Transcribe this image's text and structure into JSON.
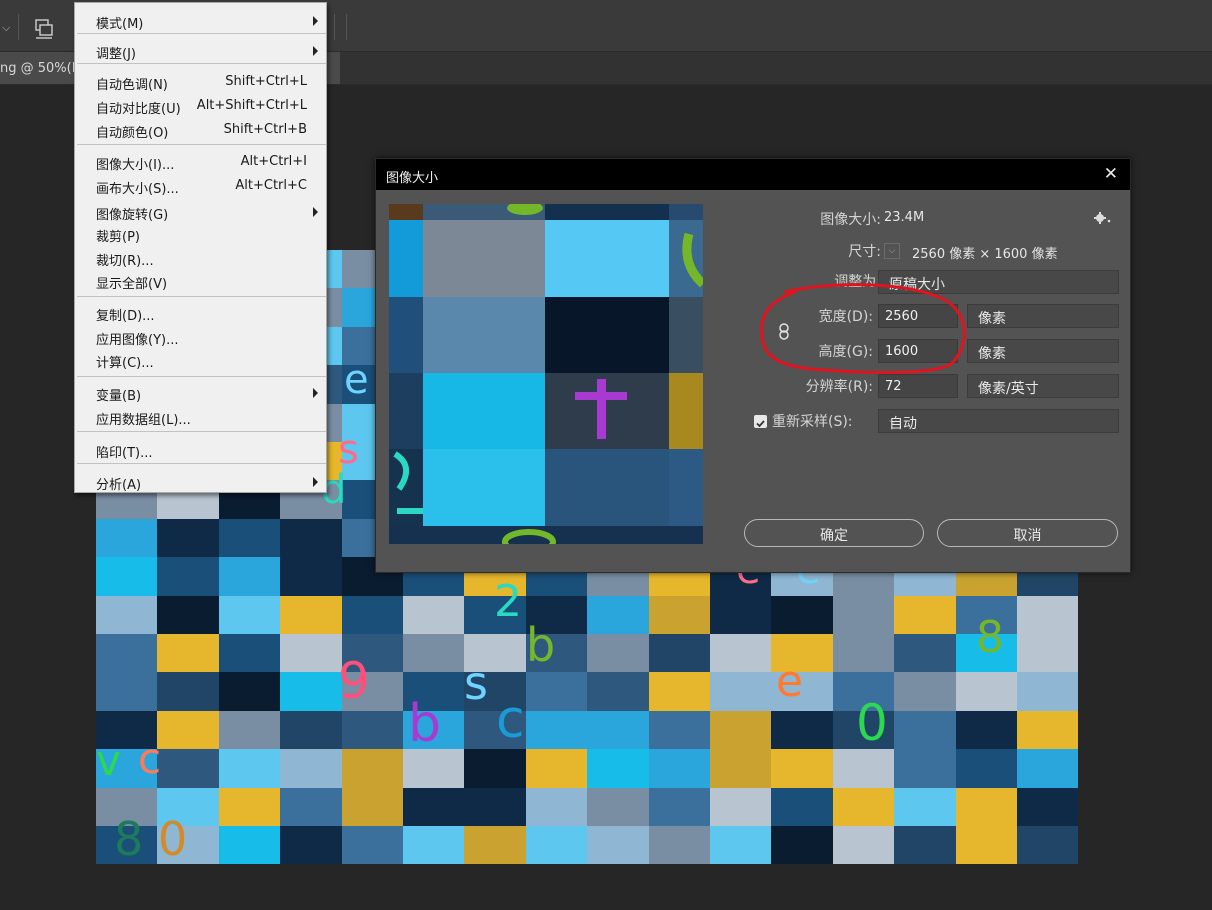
{
  "document": {
    "tab_title": "ng @ 50%(R"
  },
  "menu": {
    "items": [
      {
        "label": "模式(M)",
        "shortcut": "",
        "submenu": true
      },
      {
        "label": "调整(J)",
        "shortcut": "",
        "submenu": true
      },
      {
        "label": "自动色调(N)",
        "shortcut": "Shift+Ctrl+L",
        "submenu": false
      },
      {
        "label": "自动对比度(U)",
        "shortcut": "Alt+Shift+Ctrl+L",
        "submenu": false
      },
      {
        "label": "自动颜色(O)",
        "shortcut": "Shift+Ctrl+B",
        "submenu": false
      },
      {
        "label": "图像大小(I)...",
        "shortcut": "Alt+Ctrl+I",
        "submenu": false
      },
      {
        "label": "画布大小(S)...",
        "shortcut": "Alt+Ctrl+C",
        "submenu": false
      },
      {
        "label": "图像旋转(G)",
        "shortcut": "",
        "submenu": true
      },
      {
        "label": "裁剪(P)",
        "shortcut": "",
        "submenu": false
      },
      {
        "label": "裁切(R)...",
        "shortcut": "",
        "submenu": false
      },
      {
        "label": "显示全部(V)",
        "shortcut": "",
        "submenu": false
      },
      {
        "label": "复制(D)...",
        "shortcut": "",
        "submenu": false
      },
      {
        "label": "应用图像(Y)...",
        "shortcut": "",
        "submenu": false
      },
      {
        "label": "计算(C)...",
        "shortcut": "",
        "submenu": false
      },
      {
        "label": "变量(B)",
        "shortcut": "",
        "submenu": true
      },
      {
        "label": "应用数据组(L)...",
        "shortcut": "",
        "submenu": false
      },
      {
        "label": "陷印(T)...",
        "shortcut": "",
        "submenu": false
      },
      {
        "label": "分析(A)",
        "shortcut": "",
        "submenu": true
      }
    ]
  },
  "dialog": {
    "title": "图像大小",
    "close_glyph": "✕",
    "image_size_label": "图像大小:",
    "image_size_value": "23.4M",
    "dimensions_label": "尺寸:",
    "dimensions_value": "2560 像素 × 1600 像素",
    "fit_to_label": "调整为:",
    "fit_to_value": "原稿大小",
    "width_label": "宽度(D):",
    "width_value": "2560",
    "width_unit": "像素",
    "height_label": "高度(G):",
    "height_value": "1600",
    "height_unit": "像素",
    "resolution_label": "分辨率(R):",
    "resolution_value": "72",
    "resolution_unit": "像素/英寸",
    "resample_label": "重新采样(S):",
    "resample_checked": true,
    "resample_value": "自动",
    "ok_label": "确定",
    "cancel_label": "取消"
  },
  "icons": {
    "gear": "gear-icon",
    "link": "chain-link-icon",
    "dimensions_toggle": "chevron-down-icon",
    "arrange": "arrange-documents-icon"
  },
  "colors": {
    "annotation_circle": "#e0141e",
    "dialog_bg": "#535353",
    "menu_bg": "#f0f0f0"
  }
}
